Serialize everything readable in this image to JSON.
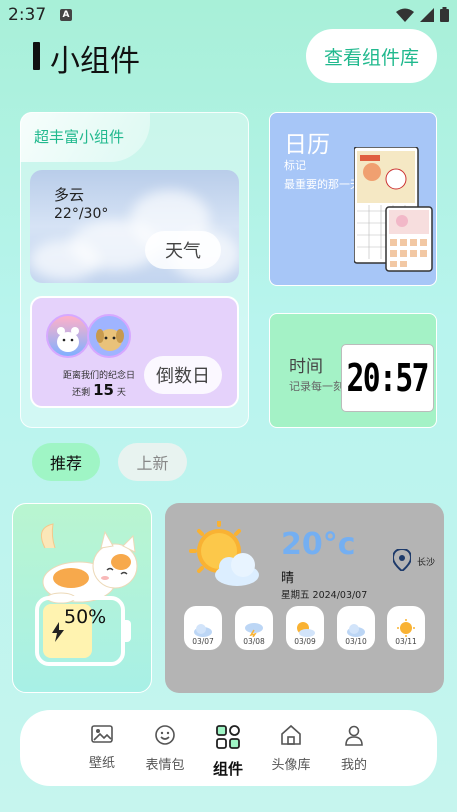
{
  "status_bar": {
    "time": "2:37",
    "notif_letter": "A"
  },
  "header": {
    "title": "小组件",
    "library_button": "查看组件库"
  },
  "featured": {
    "tab_label": "超丰富小组件",
    "weather": {
      "condition": "多云",
      "temp_range": "22°/30°",
      "button": "天气"
    },
    "countdown": {
      "note": "距离我们的纪念日",
      "prefix": "还剩",
      "days": "15",
      "suffix": "天",
      "button": "倒数日"
    }
  },
  "calendar_card": {
    "title": "日历",
    "line1": "标记",
    "line2": "最重要的那一天"
  },
  "time_card": {
    "title": "时间",
    "subtitle": "记录每一刻",
    "clock": "20:57"
  },
  "filters": {
    "recommended": "推荐",
    "new": "上新"
  },
  "battery_widget": {
    "percent": "50%",
    "level": 0.5
  },
  "weather_widget": {
    "temp": "20°c",
    "condition": "晴",
    "date": "星期五 2024/03/07",
    "city": "长沙",
    "forecast": [
      {
        "date": "03/07",
        "icon": "cloud-icon"
      },
      {
        "date": "03/08",
        "icon": "storm-icon"
      },
      {
        "date": "03/09",
        "icon": "partly-cloudy-icon"
      },
      {
        "date": "03/10",
        "icon": "cloud-icon"
      },
      {
        "date": "03/11",
        "icon": "sun-icon"
      }
    ]
  },
  "bottom_nav": [
    {
      "label": "壁纸",
      "icon": "image-icon"
    },
    {
      "label": "表情包",
      "icon": "emoji-icon"
    },
    {
      "label": "组件",
      "icon": "widgets-icon"
    },
    {
      "label": "头像库",
      "icon": "home-icon"
    },
    {
      "label": "我的",
      "icon": "person-icon"
    }
  ],
  "colors": {
    "accent": "#21b98e",
    "calendar": "#a7c6f7",
    "time": "#a4f2c6",
    "countdown": "#e5d2fb"
  }
}
